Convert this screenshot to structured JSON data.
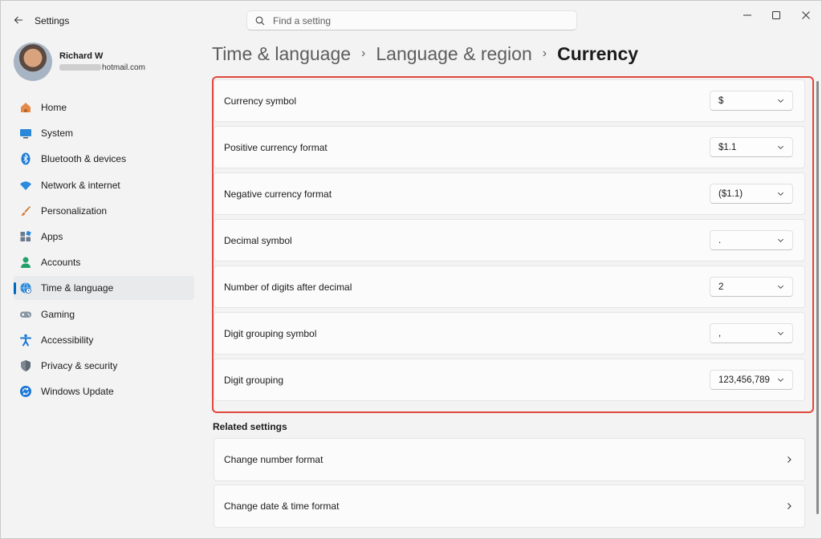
{
  "window": {
    "title": "Settings",
    "search_placeholder": "Find a setting"
  },
  "profile": {
    "name": "Richard W",
    "email_visible": "hotmail.com"
  },
  "sidebar": {
    "items": [
      {
        "label": "Home",
        "icon": "home-icon"
      },
      {
        "label": "System",
        "icon": "system-icon"
      },
      {
        "label": "Bluetooth & devices",
        "icon": "bluetooth-icon"
      },
      {
        "label": "Network & internet",
        "icon": "wifi-icon"
      },
      {
        "label": "Personalization",
        "icon": "brush-icon"
      },
      {
        "label": "Apps",
        "icon": "apps-icon"
      },
      {
        "label": "Accounts",
        "icon": "person-icon"
      },
      {
        "label": "Time & language",
        "icon": "globe-clock-icon",
        "active": true
      },
      {
        "label": "Gaming",
        "icon": "gamepad-icon"
      },
      {
        "label": "Accessibility",
        "icon": "accessibility-icon"
      },
      {
        "label": "Privacy & security",
        "icon": "shield-icon"
      },
      {
        "label": "Windows Update",
        "icon": "update-icon"
      }
    ]
  },
  "breadcrumb": {
    "items": [
      "Time & language",
      "Language & region",
      "Currency"
    ],
    "separator": "›"
  },
  "currency_settings": [
    {
      "label": "Currency symbol",
      "value": "$"
    },
    {
      "label": "Positive currency format",
      "value": "$1.1"
    },
    {
      "label": "Negative currency format",
      "value": "($1.1)"
    },
    {
      "label": "Decimal symbol",
      "value": "."
    },
    {
      "label": "Number of digits after decimal",
      "value": "2"
    },
    {
      "label": "Digit grouping symbol",
      "value": ","
    },
    {
      "label": "Digit grouping",
      "value": "123,456,789"
    }
  ],
  "related": {
    "title": "Related settings",
    "items": [
      {
        "label": "Change number format"
      },
      {
        "label": "Change date & time format"
      }
    ]
  },
  "colors": {
    "accent": "#0067c0",
    "highlight_border": "#e0483c",
    "window_bg": "#f3f3f3",
    "card_bg": "#fbfbfb"
  }
}
